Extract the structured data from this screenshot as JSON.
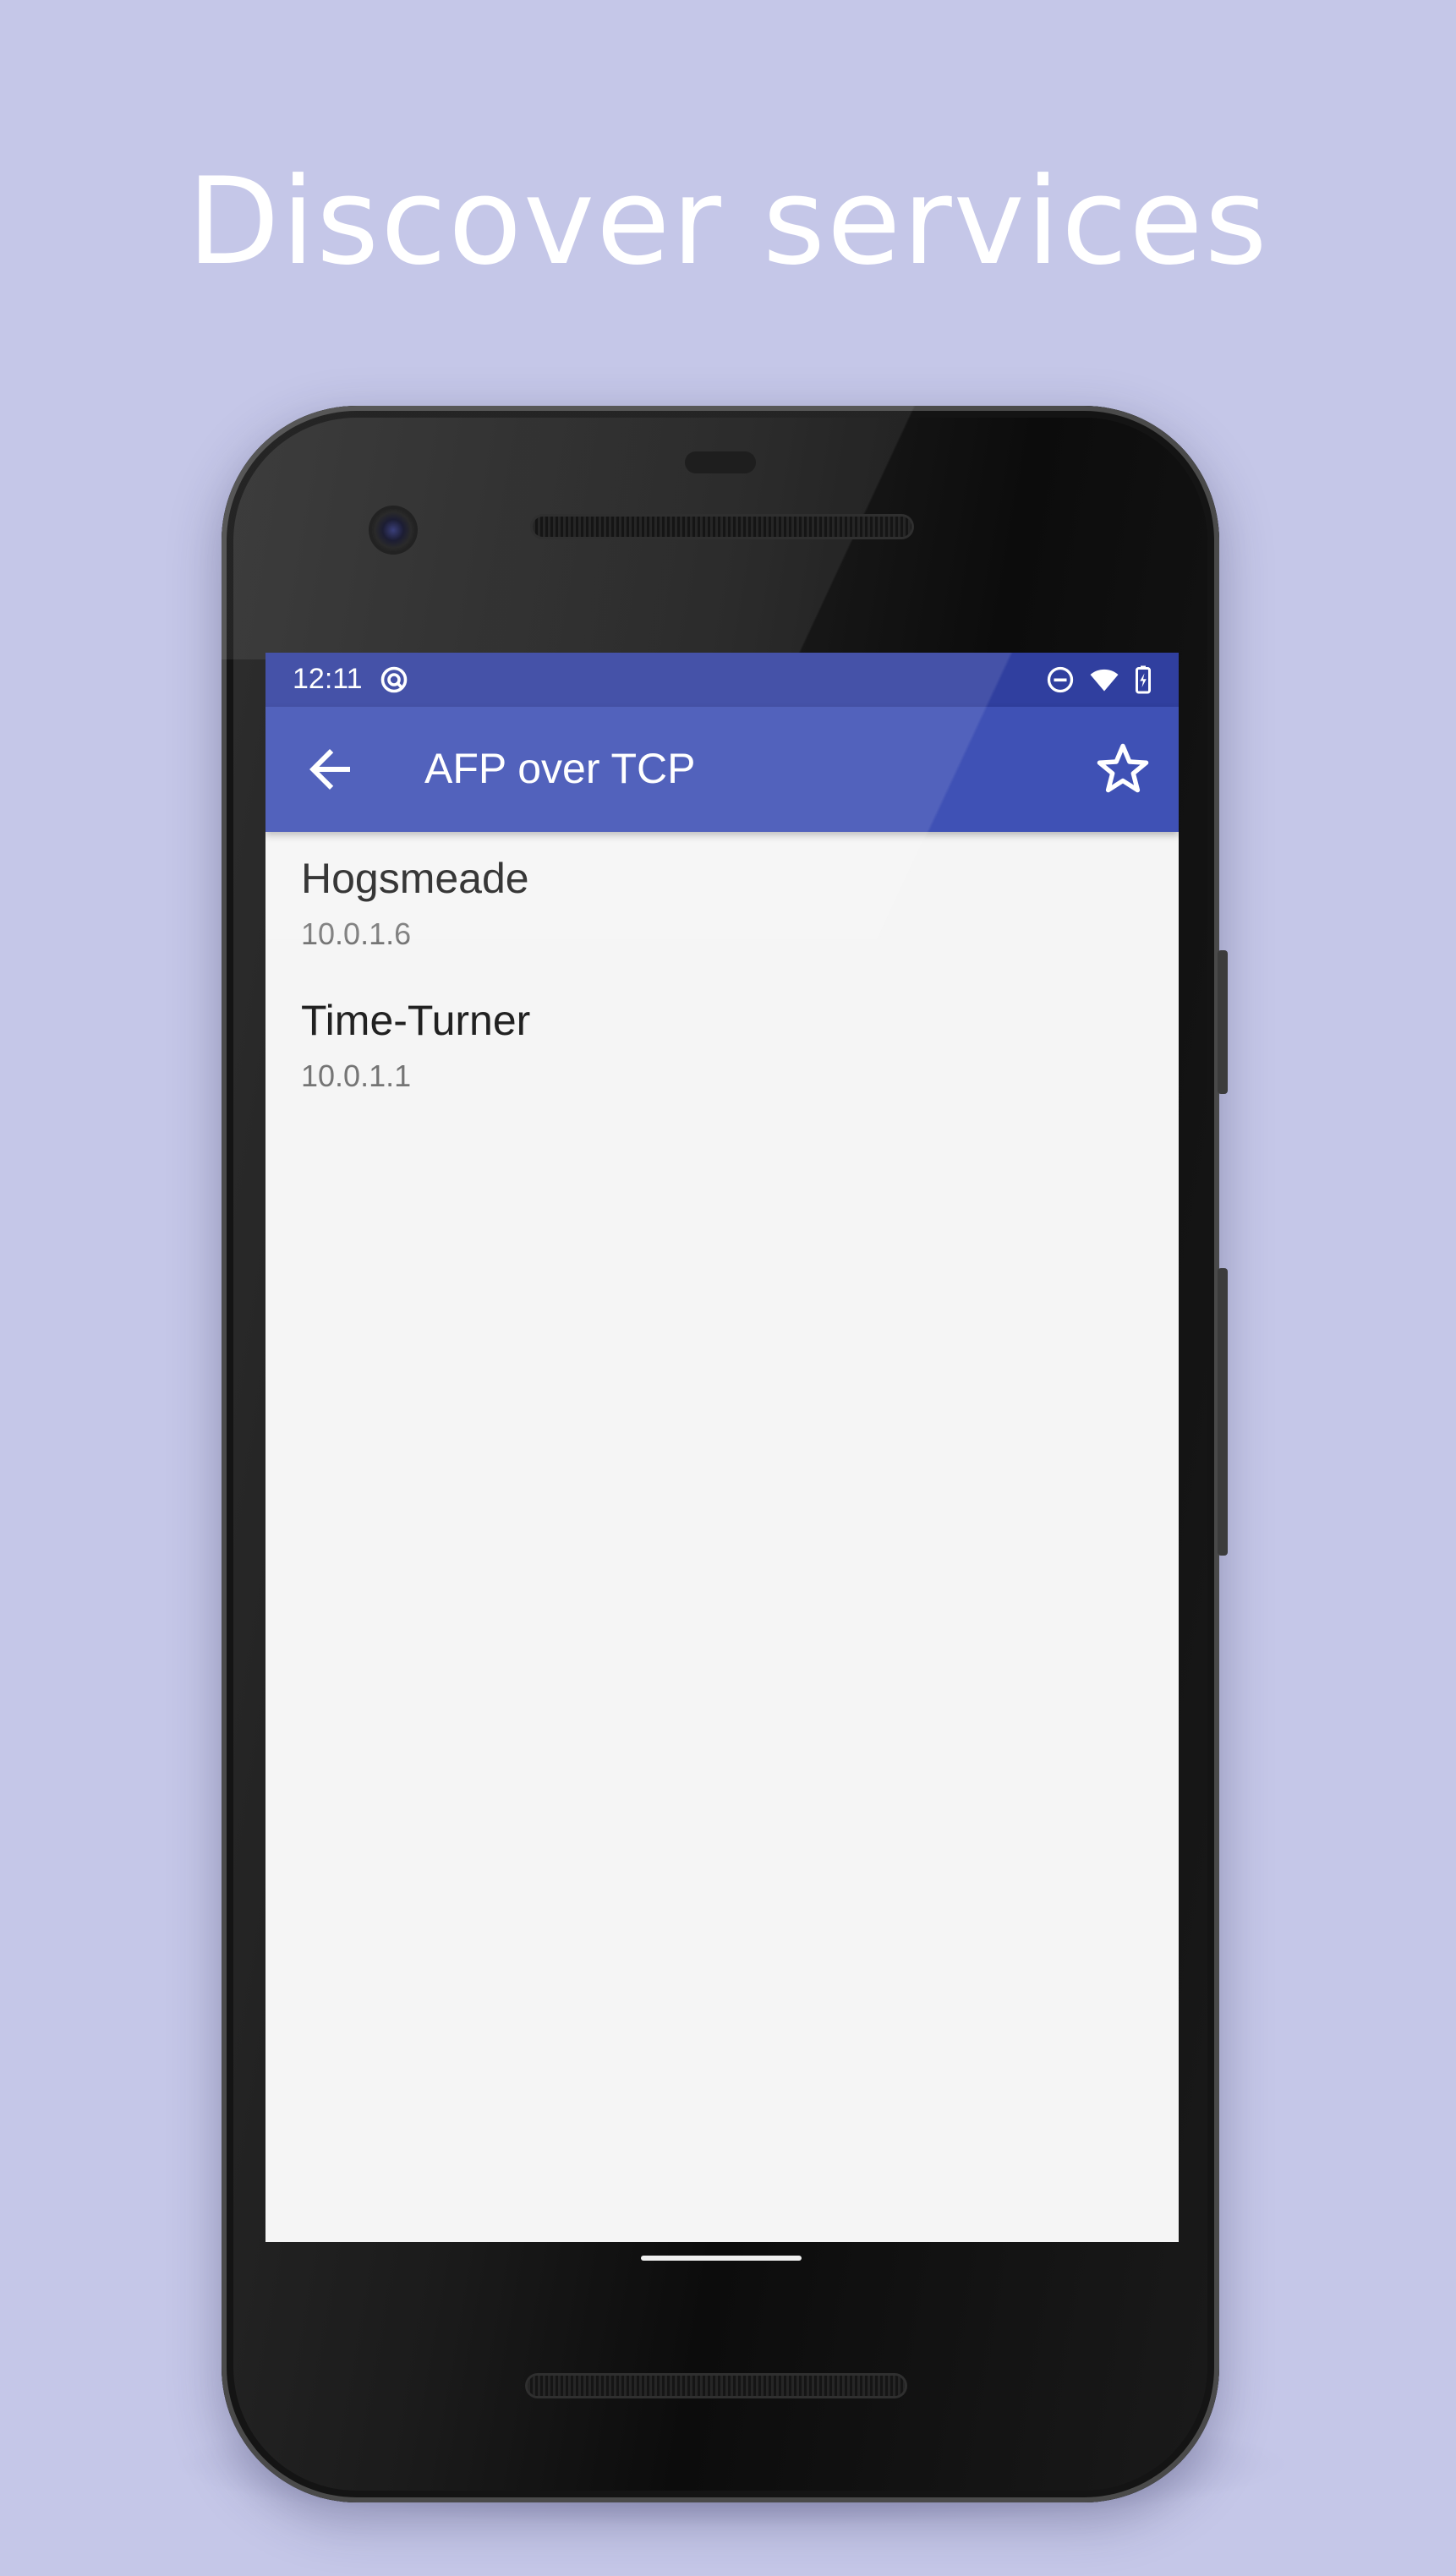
{
  "headline": "Discover services",
  "colors": {
    "background": "#c5c7e8",
    "status_bar": "#303f9f",
    "app_bar": "#3f51b5",
    "content_bg": "#f5f5f5"
  },
  "status_bar": {
    "time": "12:11",
    "icons": [
      "sync-icon",
      "do-not-disturb-icon",
      "wifi-icon",
      "battery-charging-icon"
    ]
  },
  "app_bar": {
    "title": "AFP over TCP",
    "back_icon": "arrow-back-icon",
    "favorite_icon": "star-outline-icon"
  },
  "services": [
    {
      "name": "Hogsmeade",
      "address": "10.0.1.6"
    },
    {
      "name": "Time-Turner",
      "address": "10.0.1.1"
    }
  ]
}
